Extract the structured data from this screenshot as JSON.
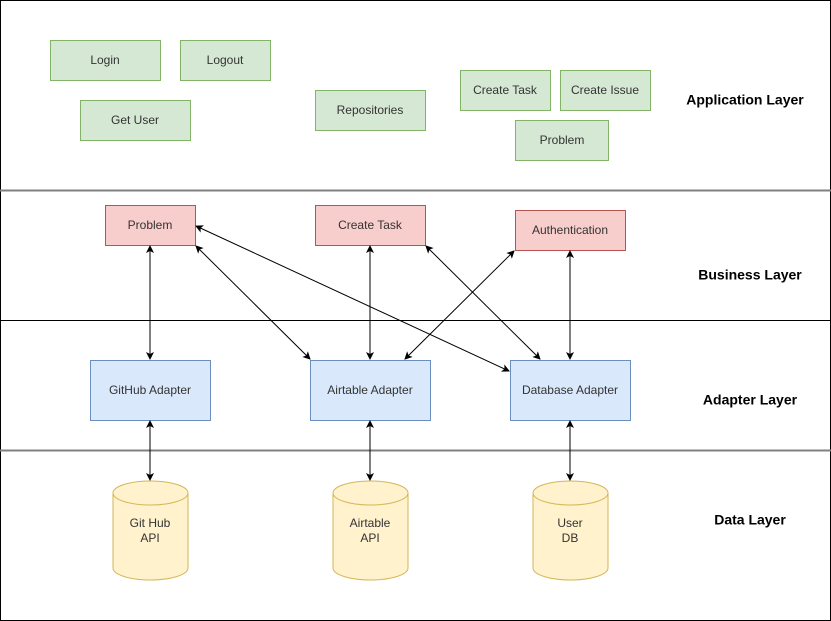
{
  "layers": [
    "Application Layer",
    "Business Layer",
    "Adapter Layer",
    "Data Layer"
  ],
  "application": [
    "Login",
    "Logout",
    "Get User",
    "Repositories",
    "Create Task",
    "Create Issue",
    "Problem"
  ],
  "business": [
    "Problem",
    "Create Task",
    "Authentication"
  ],
  "adapters": [
    "GitHub Adapter",
    "Airtable Adapter",
    "Database Adapter"
  ],
  "data": [
    [
      "Git Hub",
      "API"
    ],
    [
      "Airtable",
      "API"
    ],
    [
      "User",
      "DB"
    ]
  ],
  "colors": {
    "application": "#d5e8d4",
    "business": "#f8cecc",
    "adapter": "#dae8fc",
    "data": "#fff2cc"
  }
}
